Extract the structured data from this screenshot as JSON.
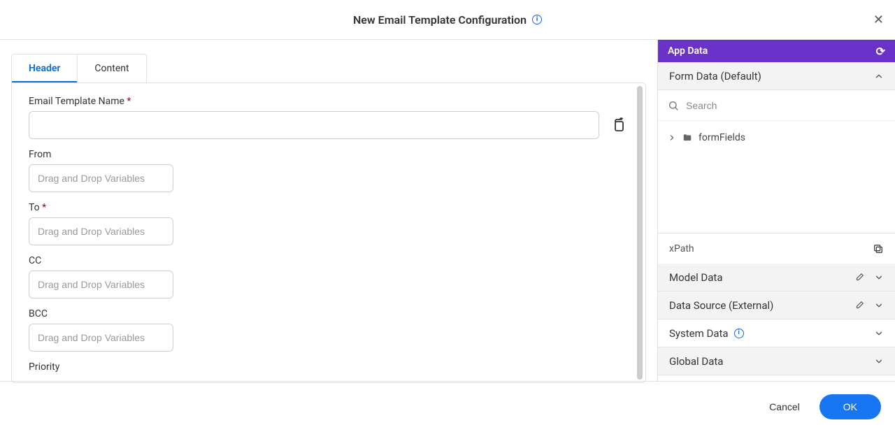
{
  "header": {
    "title": "New Email Template Configuration"
  },
  "tabs": {
    "header": "Header",
    "content": "Content"
  },
  "form": {
    "template_name_label": "Email Template Name",
    "from_label": "From",
    "to_label": "To",
    "cc_label": "CC",
    "bcc_label": "BCC",
    "priority_label": "Priority",
    "drag_placeholder": "Drag and Drop Variables"
  },
  "sidebar": {
    "app_data_title": "App Data",
    "form_data_title": "Form Data (Default)",
    "search_placeholder": "Search",
    "tree_item": "formFields",
    "xpath_label": "xPath",
    "model_data": "Model Data",
    "data_source": "Data Source (External)",
    "system_data": "System Data",
    "global_data": "Global Data"
  },
  "footer": {
    "cancel": "Cancel",
    "ok": "OK"
  }
}
